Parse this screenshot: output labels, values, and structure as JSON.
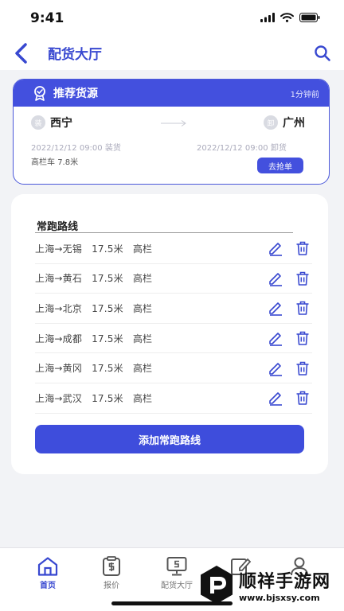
{
  "status_bar": {
    "time": "9:41"
  },
  "nav": {
    "title": "配货大厅"
  },
  "recommend": {
    "title": "推荐货源",
    "time_ago": "1分钟前",
    "from_city": "西宁",
    "from_badge": "装",
    "to_city": "广州",
    "to_badge": "卸",
    "load_date": "2022/12/12",
    "load_time": "09:00",
    "load_label": "装货",
    "unload_date": "2022/12/12",
    "unload_time": "09:00",
    "unload_label": "卸货",
    "truck_type": "高栏车",
    "truck_length": "7.8米",
    "grab_button": "去抢单"
  },
  "routes": {
    "title": "常跑路线",
    "items": [
      {
        "path": "上海→无锡",
        "length": "17.5米",
        "type": "高栏"
      },
      {
        "path": "上海→黄石",
        "length": "17.5米",
        "type": "高栏"
      },
      {
        "path": "上海→北京",
        "length": "17.5米",
        "type": "高栏"
      },
      {
        "path": "上海→成都",
        "length": "17.5米",
        "type": "高栏"
      },
      {
        "path": "上海→黄冈",
        "length": "17.5米",
        "type": "高栏"
      },
      {
        "path": "上海→武汉",
        "length": "17.5米",
        "type": "高栏"
      }
    ],
    "add_button": "添加常跑路线"
  },
  "tabs": [
    {
      "label": "首页",
      "icon": "home-icon",
      "active": true
    },
    {
      "label": "报价",
      "icon": "quote-icon",
      "active": false
    },
    {
      "label": "配货大厅",
      "icon": "hall-icon",
      "active": false
    },
    {
      "label": "",
      "icon": "edit-icon",
      "active": false
    },
    {
      "label": "",
      "icon": "user-icon",
      "active": false
    }
  ],
  "watermark": {
    "name": "顺祥手游网",
    "url": "www.bjsxsy.com"
  },
  "colors": {
    "primary": "#3e4ddc",
    "title": "#3848d0",
    "background": "#f2f3f6"
  }
}
